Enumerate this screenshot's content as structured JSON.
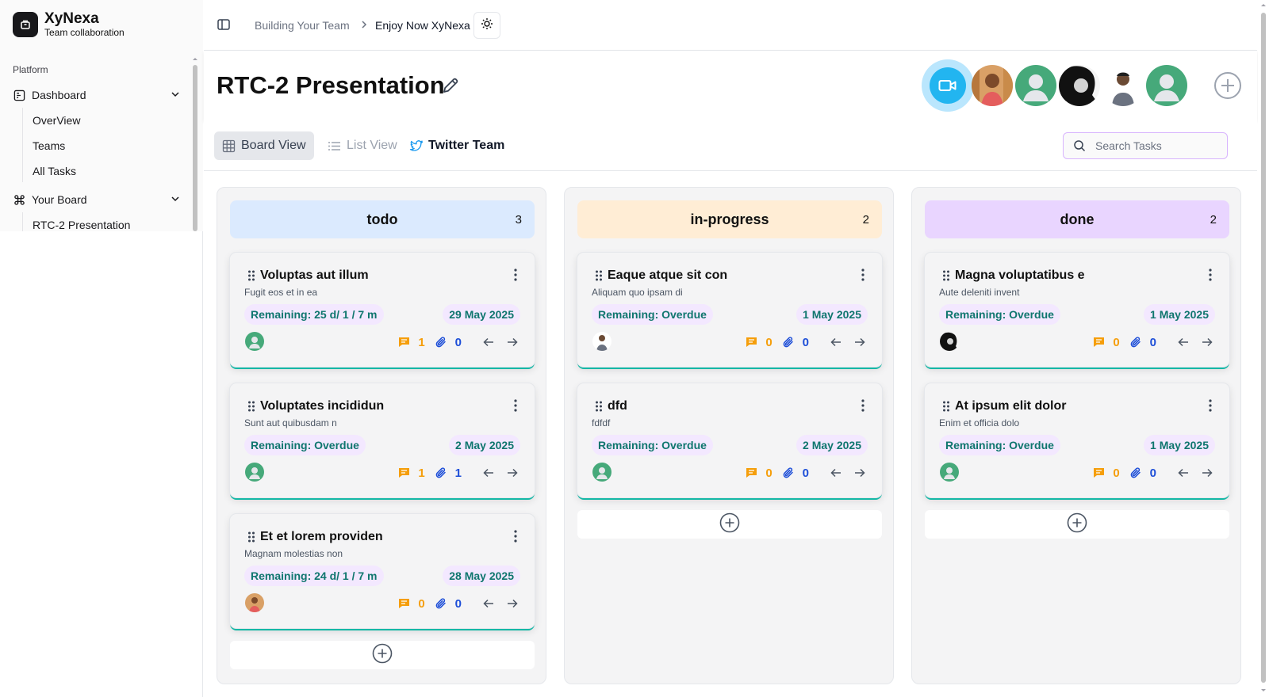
{
  "brand": {
    "name": "XyNexa",
    "subtitle": "Team collaboration"
  },
  "sidebar": {
    "group_label": "Platform",
    "dashboard": {
      "label": "Dashboard",
      "icon": "dashboard-icon",
      "items": [
        "OverView",
        "Teams",
        "All Tasks"
      ]
    },
    "board": {
      "label": "Your Board",
      "icon": "command-icon",
      "items": [
        "RTC-2 Presentation"
      ]
    }
  },
  "breadcrumb": {
    "first": "Building Your Team",
    "second": "Enjoy Now XyNexa"
  },
  "page": {
    "title": "RTC-2 Presentation"
  },
  "views": {
    "board": "Board View",
    "list": "List View",
    "team": "Twitter Team"
  },
  "search": {
    "placeholder": "Search Tasks"
  },
  "colors": {
    "accent": "#14b8a6",
    "todo": "#dbeafe",
    "in_progress": "#ffedd5",
    "done": "#e9d5ff",
    "pill": "#f3e8ff",
    "remaining_text": "#0f766e",
    "comment": "#f59e0b",
    "attach": "#1d4ed8"
  },
  "columns": [
    {
      "title": "todo",
      "count": "3",
      "cards": [
        {
          "title": "Voluptas aut illum",
          "desc": "Fugit eos et in ea",
          "remaining": "Remaining: 25 d/ 1 / 7 m",
          "date": "29 May 2025",
          "avatar": "default",
          "comments": "1",
          "attachments": "0"
        },
        {
          "title": "Voluptates incididun",
          "desc": "Sunt aut quibusdam n",
          "remaining": "Remaining: Overdue",
          "date": "2 May 2025",
          "avatar": "default",
          "comments": "1",
          "attachments": "1"
        },
        {
          "title": "Et et lorem providen",
          "desc": "Magnam molestias non",
          "remaining": "Remaining: 24 d/ 1 / 7 m",
          "date": "28 May 2025",
          "avatar": "photo-warm",
          "comments": "0",
          "attachments": "0"
        }
      ]
    },
    {
      "title": "in-progress",
      "count": "2",
      "cards": [
        {
          "title": "Eaque atque sit con",
          "desc": "Aliquam quo ipsam di",
          "remaining": "Remaining: Overdue",
          "date": "1 May 2025",
          "avatar": "photo-man",
          "comments": "0",
          "attachments": "0"
        },
        {
          "title": "dfd",
          "desc": "fdfdf",
          "remaining": "Remaining: Overdue",
          "date": "2 May 2025",
          "avatar": "default",
          "comments": "0",
          "attachments": "0"
        }
      ]
    },
    {
      "title": "done",
      "count": "2",
      "cards": [
        {
          "title": "Magna voluptatibus e",
          "desc": "Aute deleniti invent",
          "remaining": "Remaining: Overdue",
          "date": "1 May 2025",
          "avatar": "photo-dark",
          "comments": "0",
          "attachments": "0"
        },
        {
          "title": "At ipsum elit dolor",
          "desc": "Enim et officia dolo",
          "remaining": "Remaining: Overdue",
          "date": "1 May 2025",
          "avatar": "default",
          "comments": "0",
          "attachments": "0"
        }
      ]
    }
  ]
}
